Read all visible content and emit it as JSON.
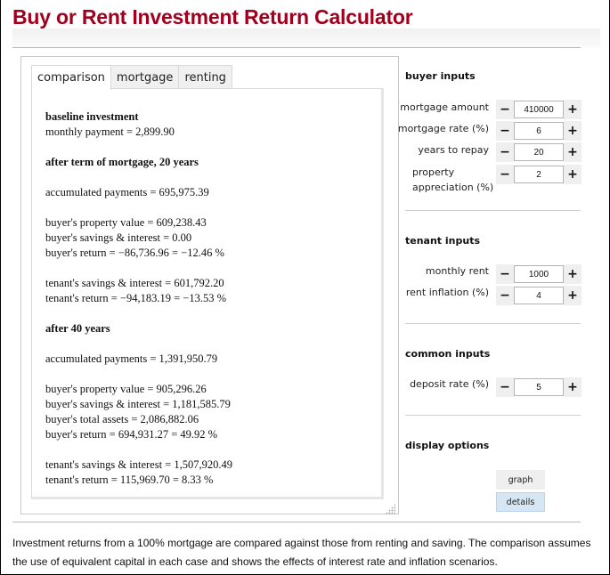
{
  "title": "Buy or Rent Investment Return Calculator",
  "tabs": [
    {
      "label": "comparison",
      "active": true
    },
    {
      "label": "mortgage",
      "active": false
    },
    {
      "label": "renting",
      "active": false
    }
  ],
  "details": {
    "baseline_heading": "baseline investment",
    "monthly_payment": "monthly payment = 2,899.90",
    "term_heading": "after term of mortgage, 20 years",
    "term_accumulated": "accumulated payments = 695,975.39",
    "term_buyer_property": "buyer's property value = 609,238.43",
    "term_buyer_savings": "buyer's savings & interest = 0.00",
    "term_buyer_return": "buyer's return = −86,736.96 = −12.46 %",
    "term_tenant_savings": "tenant's savings & interest = 601,792.20",
    "term_tenant_return": "tenant's return = −94,183.19 = −13.53 %",
    "forty_heading": "after 40 years",
    "forty_accumulated": "accumulated payments = 1,391,950.79",
    "forty_buyer_property": "buyer's property value = 905,296.26",
    "forty_buyer_savings": "buyer's savings & interest = 1,181,585.79",
    "forty_buyer_total": "buyer's total assets = 2,086,882.06",
    "forty_buyer_return": "buyer's return = 694,931.27 = 49.92 %",
    "forty_tenant_savings": "tenant's savings & interest = 1,507,920.49",
    "forty_tenant_return": "tenant's return = 115,969.70 = 8.33 %"
  },
  "buyer_inputs": {
    "title": "buyer inputs",
    "mortgage_amount": {
      "label": "mortgage amount",
      "value": "410000"
    },
    "mortgage_rate": {
      "label": "mortgage rate (%)",
      "value": "6"
    },
    "years_to_repay": {
      "label": "years to repay",
      "value": "20"
    },
    "property_appreciation": {
      "label": "property appreciation (%)",
      "value": "2"
    }
  },
  "tenant_inputs": {
    "title": "tenant inputs",
    "monthly_rent": {
      "label": "monthly rent",
      "value": "1000"
    },
    "rent_inflation": {
      "label": "rent inflation (%)",
      "value": "4"
    }
  },
  "common_inputs": {
    "title": "common inputs",
    "deposit_rate": {
      "label": "deposit rate (%)",
      "value": "5"
    }
  },
  "display_options": {
    "title": "display options",
    "graph_label": "graph",
    "details_label": "details",
    "selected": "details"
  },
  "stepper": {
    "minus": "−",
    "plus": "+"
  },
  "footer": "Investment returns from a 100% mortgage are compared against those from renting and saving. The comparison assumes the use of equivalent capital in each case and shows the effects of interest rate and inflation scenarios."
}
